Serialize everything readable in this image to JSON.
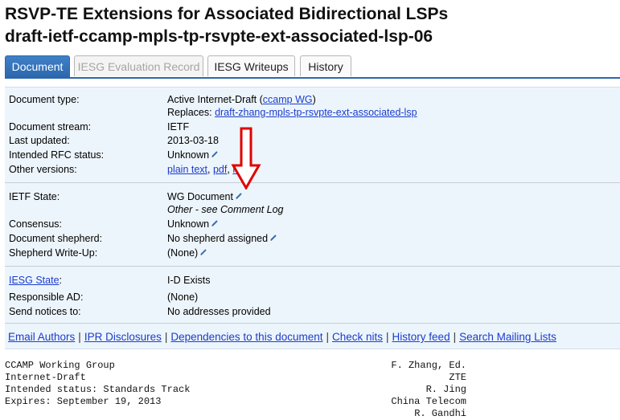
{
  "header": {
    "title": "RSVP-TE Extensions for Associated Bidirectional LSPs",
    "draft_name": "draft-ietf-ccamp-mpls-tp-rsvpte-ext-associated-lsp-06"
  },
  "tabs": [
    {
      "label": "Document",
      "state": "active"
    },
    {
      "label": "IESG Evaluation Record",
      "state": "disabled"
    },
    {
      "label": "IESG Writeups",
      "state": "normal"
    },
    {
      "label": "History",
      "state": "normal"
    }
  ],
  "info": {
    "doc_type_label": "Document type:",
    "doc_type_value": "Active Internet-Draft (",
    "doc_type_wg": "ccamp WG",
    "doc_type_close": ")",
    "replaces_prefix": "Replaces: ",
    "replaces_link": "draft-zhang-mpls-tp-rsvpte-ext-associated-lsp",
    "stream_label": "Document stream:",
    "stream_value": "IETF",
    "updated_label": "Last updated:",
    "updated_value": "2013-03-18",
    "rfc_status_label": "Intended RFC status:",
    "rfc_status_value": "Unknown",
    "versions_label": "Other versions:",
    "versions": [
      "plain text",
      "pdf",
      "html"
    ],
    "ietf_state_label": "IETF State:",
    "ietf_state_value": "WG Document",
    "ietf_state_note": "Other - see Comment Log",
    "consensus_label": "Consensus:",
    "consensus_value": "Unknown",
    "shepherd_label": "Document shepherd:",
    "shepherd_value": "No shepherd assigned",
    "writeup_label": "Shepherd Write-Up:",
    "writeup_value": "(None)",
    "iesg_state_label": "IESG State",
    "iesg_state_colon": ":",
    "iesg_state_value": "I-D Exists",
    "ad_label": "Responsible AD:",
    "ad_value": "(None)",
    "notices_label": "Send notices to:",
    "notices_value": "No addresses provided"
  },
  "footer_links": [
    "Email Authors",
    "IPR Disclosures",
    "Dependencies to this document",
    "Check nits",
    "History feed",
    "Search Mailing Lists"
  ],
  "doc_text": {
    "left": [
      "CCAMP Working Group",
      "Internet-Draft",
      "Intended status: Standards Track",
      "Expires: September 19, 2013"
    ],
    "right": [
      "F. Zhang, Ed.",
      "ZTE",
      "R. Jing",
      "China Telecom",
      "R. Gandhi"
    ]
  },
  "colors": {
    "accent": "#2c67ad",
    "panel": "#edf5fc",
    "link": "#1a3ccc",
    "arrow": "#e00000"
  },
  "icons": {
    "edit": "pencil-icon",
    "annotation": "red-down-arrow"
  }
}
